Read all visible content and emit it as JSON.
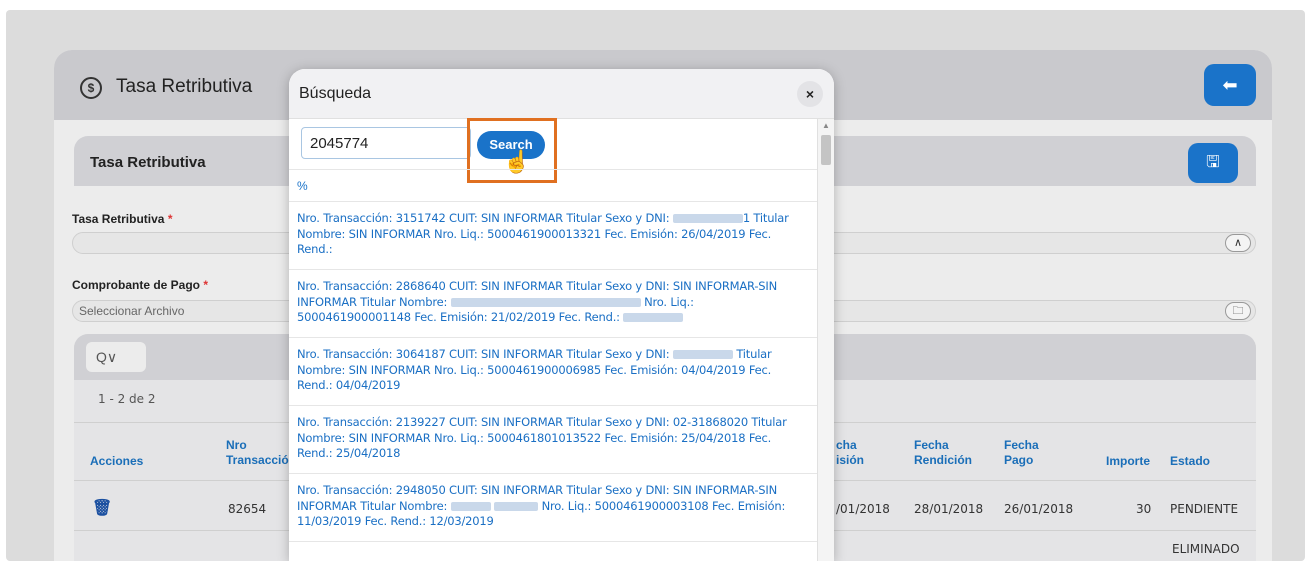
{
  "page": {
    "title": "Tasa Retributiva",
    "back_icon": "arrow-left-icon",
    "title_icon": "dollar-circle-icon"
  },
  "form": {
    "panel_title": "Tasa Retributiva",
    "save_icon": "save-icon",
    "tasa_label": "Tasa Retributiva",
    "required_mark": "*",
    "tasa_value": "",
    "comprobante_label": "Comprobante de Pago",
    "comprobante_placeholder": "Seleccionar Archivo"
  },
  "grid": {
    "search_icon": "Q∨",
    "paging": "1 - 2 de 2",
    "columns": [
      "Acciones",
      "Nro Transacción",
      "Fecha Emisión",
      "Fecha Rendición",
      "Fecha Pago",
      "Importe",
      "Estado"
    ],
    "column_labels": {
      "acciones": "Acciones",
      "nro": "Nro\nTransacción",
      "emision": "cha\nisión",
      "rendicion": "Fecha\nRendición",
      "pago": "Fecha\nPago",
      "importe": "Importe",
      "estado": "Estado"
    },
    "rows": [
      {
        "nro": "82654",
        "emision": "/01/2018",
        "rendicion": "28/01/2018",
        "pago": "26/01/2018",
        "importe": "30",
        "estado": "PENDIENTE"
      },
      {
        "estado": "ELIMINADO"
      }
    ]
  },
  "modal": {
    "title": "Búsqueda",
    "close_label": "×",
    "search_value": "2045774",
    "search_button": "Search",
    "wildcard": "%",
    "results": [
      {
        "part1": "Nro. Transacción: 3151742 CUIT: SIN INFORMAR Titular Sexo y DNI:",
        "part2": "1 Titular Nombre: SIN INFORMAR Nro. Liq.: 5000461900013321 Fec. Emisión: 26/04/2019 Fec. Rend.:"
      },
      {
        "part1": "Nro. Transacción: 2868640 CUIT: SIN INFORMAR Titular Sexo y DNI: SIN INFORMAR-SIN INFORMAR Titular Nombre:",
        "part2": "Nro. Liq.: 5000461900001148 Fec. Emisión: 21/02/2019 Fec. Rend.:"
      },
      {
        "part1": "Nro. Transacción: 3064187 CUIT: SIN INFORMAR Titular Sexo y DNI:",
        "part2": "Titular Nombre: SIN INFORMAR Nro. Liq.: 5000461900006985 Fec. Emisión: 04/04/2019 Fec. Rend.: 04/04/2019"
      },
      {
        "part1": "Nro. Transacción: 2139227 CUIT: SIN INFORMAR Titular Sexo y DNI: 02-31868020 Titular Nombre: SIN INFORMAR Nro. Liq.: 5000461801013522 Fec. Emisión: 25/04/2018 Fec. Rend.: 25/04/2018",
        "part2": ""
      },
      {
        "part1": "Nro. Transacción: 2948050 CUIT: SIN INFORMAR Titular Sexo y DNI: SIN INFORMAR-SIN INFORMAR Titular Nombre:",
        "part2": "Nro. Liq.: 5000461900003108 Fec. Emisión: 11/03/2019 Fec. Rend.: 12/03/2019"
      }
    ]
  }
}
